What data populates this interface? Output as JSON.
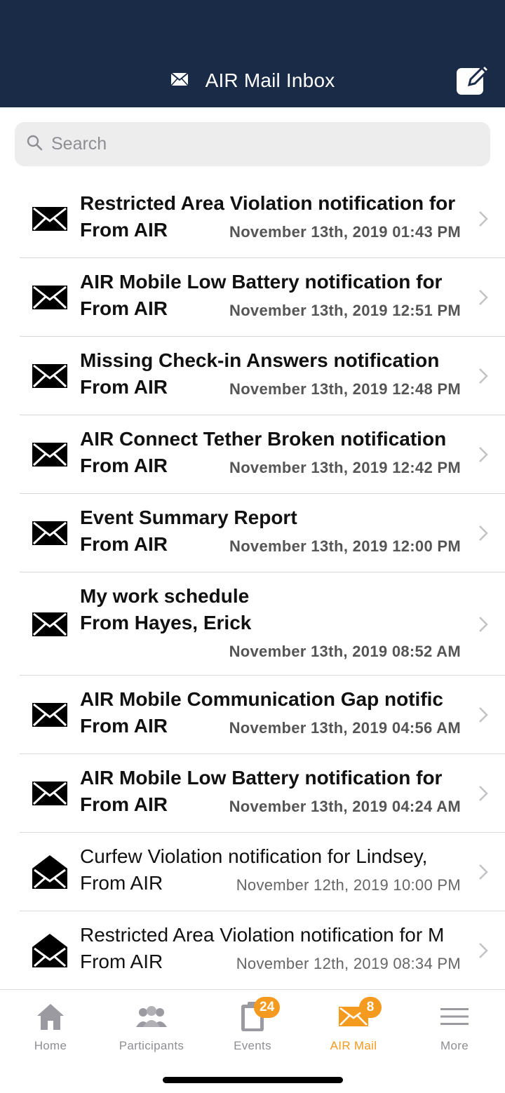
{
  "header": {
    "title": "AIR Mail Inbox",
    "title_icon": "envelope-icon",
    "compose_icon": "compose-icon",
    "background": "#1a2b47"
  },
  "search": {
    "placeholder": "Search",
    "value": ""
  },
  "messages": [
    {
      "subject": "Restricted Area Violation notification for",
      "from": "From AIR",
      "date": "November 13th, 2019 01:43 PM",
      "unread": true
    },
    {
      "subject": "AIR Mobile Low Battery notification for",
      "from": "From AIR",
      "date": "November 13th, 2019 12:51 PM",
      "unread": true
    },
    {
      "subject": "Missing Check-in Answers notification",
      "from": "From AIR",
      "date": "November 13th, 2019 12:48 PM",
      "unread": true
    },
    {
      "subject": "AIR Connect Tether Broken notification",
      "from": "From AIR",
      "date": "November 13th, 2019 12:42 PM",
      "unread": true
    },
    {
      "subject": "Event Summary Report",
      "from": "From AIR",
      "date": "November 13th, 2019 12:00 PM",
      "unread": true
    },
    {
      "subject": "My work schedule",
      "from": "From Hayes, Erick",
      "date": "November 13th, 2019 08:52 AM",
      "unread": true
    },
    {
      "subject": "AIR Mobile Communication Gap notific",
      "from": "From AIR",
      "date": "November 13th, 2019 04:56 AM",
      "unread": true
    },
    {
      "subject": "AIR Mobile Low Battery notification for",
      "from": "From AIR",
      "date": "November 13th, 2019 04:24 AM",
      "unread": true
    },
    {
      "subject": "Curfew Violation notification for Lindsey,",
      "from": "From AIR",
      "date": "November 12th, 2019 10:00 PM",
      "unread": false
    },
    {
      "subject": "Restricted Area Violation notification for M",
      "from": "From AIR",
      "date": "November 12th, 2019 08:34 PM",
      "unread": false
    }
  ],
  "tabbar": {
    "tabs": [
      {
        "label": "Home",
        "icon": "home-icon",
        "badge": ""
      },
      {
        "label": "Participants",
        "icon": "participants-icon",
        "badge": ""
      },
      {
        "label": "Events",
        "icon": "clipboard-icon",
        "badge": "24"
      },
      {
        "label": "AIR Mail",
        "icon": "mail-icon",
        "badge": "8"
      },
      {
        "label": "More",
        "icon": "menu-icon",
        "badge": ""
      }
    ],
    "active": "AIR Mail",
    "accent": "#f39a1f",
    "inactive_color": "#8e8e93"
  }
}
